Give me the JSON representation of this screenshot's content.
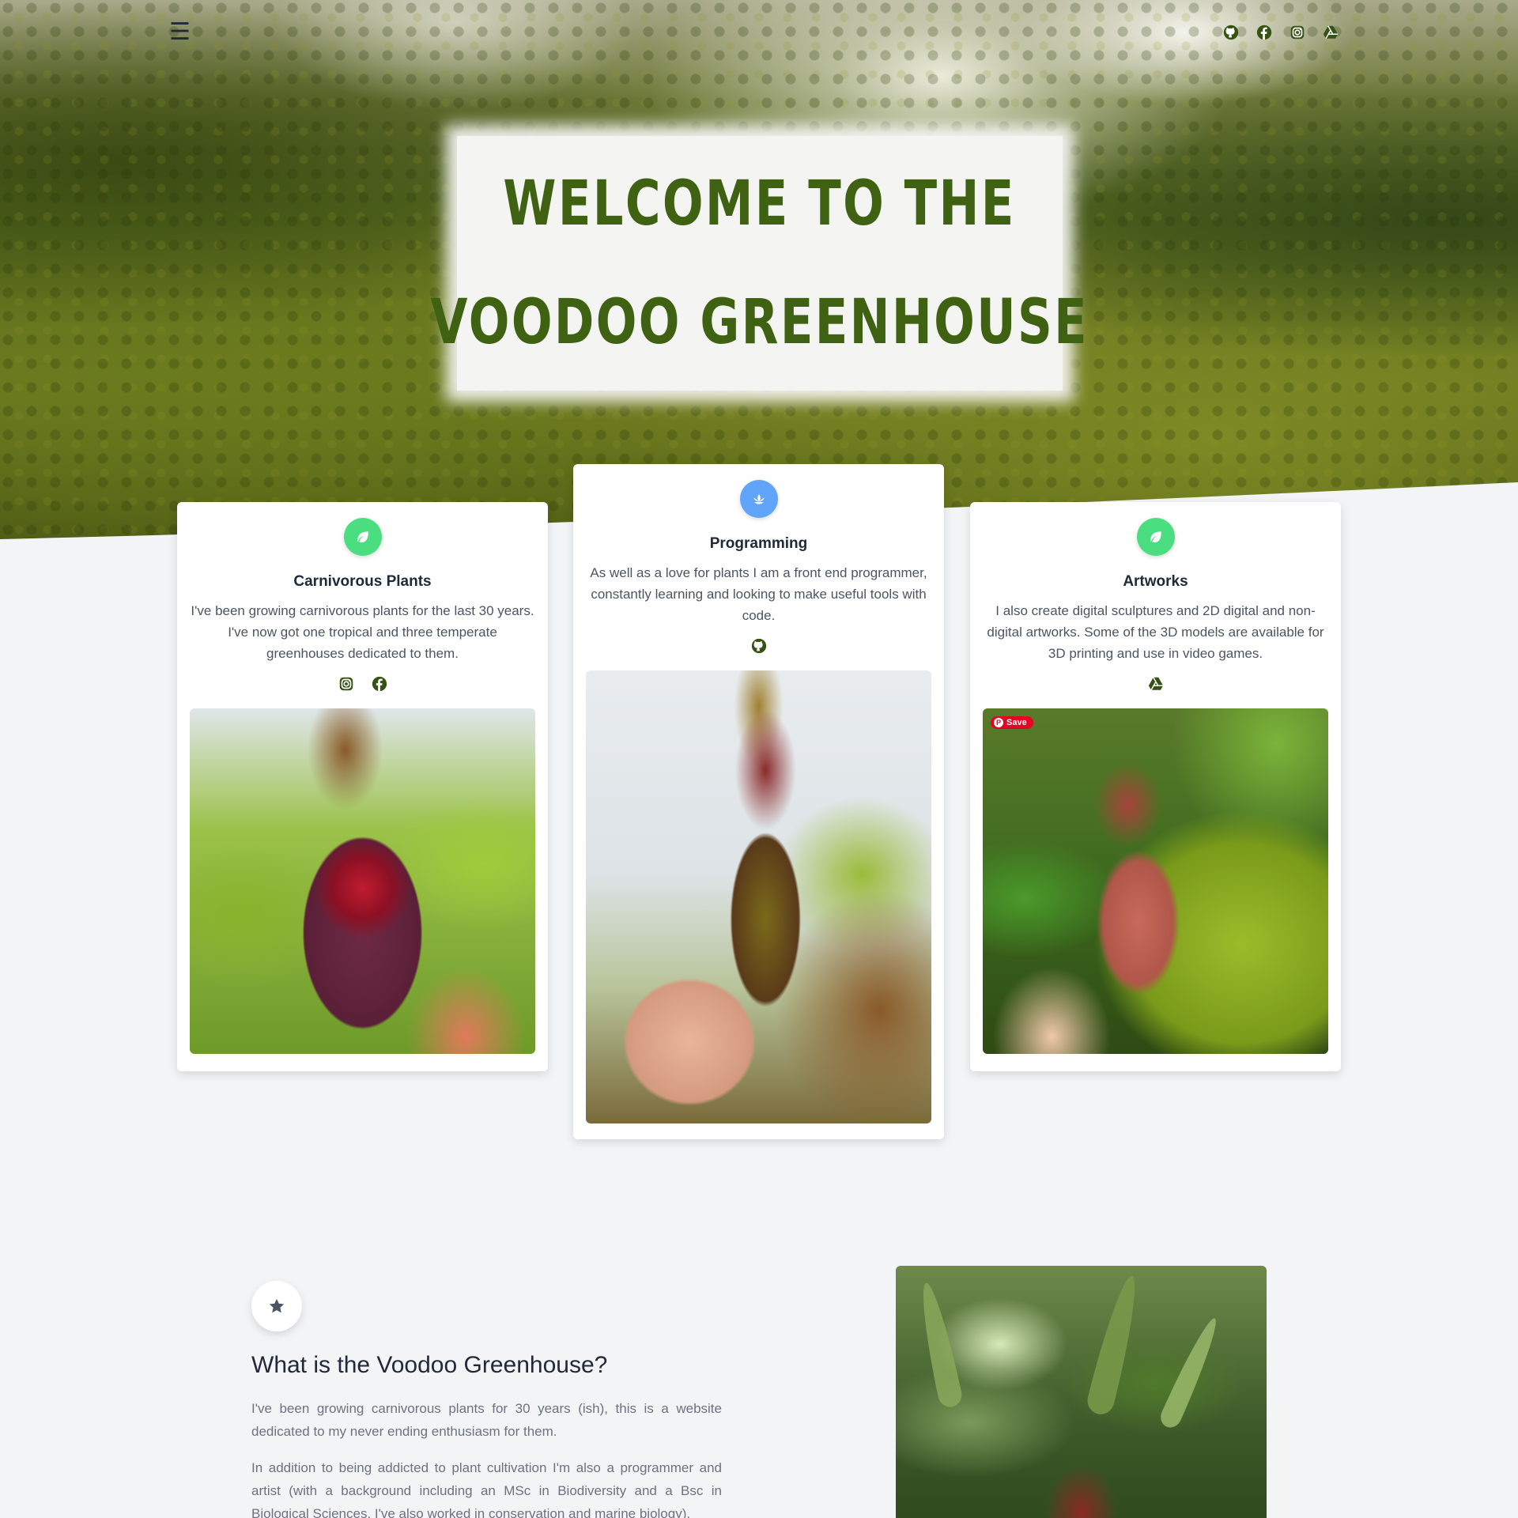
{
  "hero": {
    "title_line1": "Welcome to the",
    "title_line2": "Voodoo Greenhouse",
    "menu_icon": "hamburger-menu-icon",
    "social_icons": [
      "github-icon",
      "facebook-icon",
      "instagram-icon",
      "google-drive-icon"
    ]
  },
  "cards": [
    {
      "title": "Carnivorous Plants",
      "text": "I've been growing carnivorous plants for the last 30 years. I've now got one tropical and three temperate greenhouses dedicated to them.",
      "badge_icon": "leaf-icon",
      "badge_color": "#4ade80",
      "social_icons": [
        "instagram-icon",
        "facebook-icon"
      ]
    },
    {
      "title": "Programming",
      "text": "As well as a love for plants I am a front end programmer, constantly learning and looking to make useful tools with code.",
      "badge_icon": "lotus-icon",
      "badge_color": "#60a5fa",
      "social_icons": [
        "github-icon"
      ]
    },
    {
      "title": "Artworks",
      "text": "I also create digital sculptures and 2D digital and non-digital artworks. Some of the 3D models are available for 3D printing and use in video games.",
      "badge_icon": "leaf-icon",
      "badge_color": "#4ade80",
      "social_icons": [
        "google-drive-icon"
      ],
      "pin_label": "Save"
    }
  ],
  "about": {
    "icon": "star-icon",
    "title": "What is the Voodoo Greenhouse?",
    "p1": "I've been growing carnivorous plants for 30 years (ish), this is a website dedicated to my never ending enthusiasm for them.",
    "p2": "In addition to being addicted to plant cultivation I'm also a programmer and artist (with a background including an MSc in Biodiversity and a Bsc in Biological Sciences. I've also worked in conservation and marine biology)."
  },
  "colors": {
    "accent_green": "#3f6212",
    "icon_green": "#365314",
    "background": "#f3f4f6"
  }
}
